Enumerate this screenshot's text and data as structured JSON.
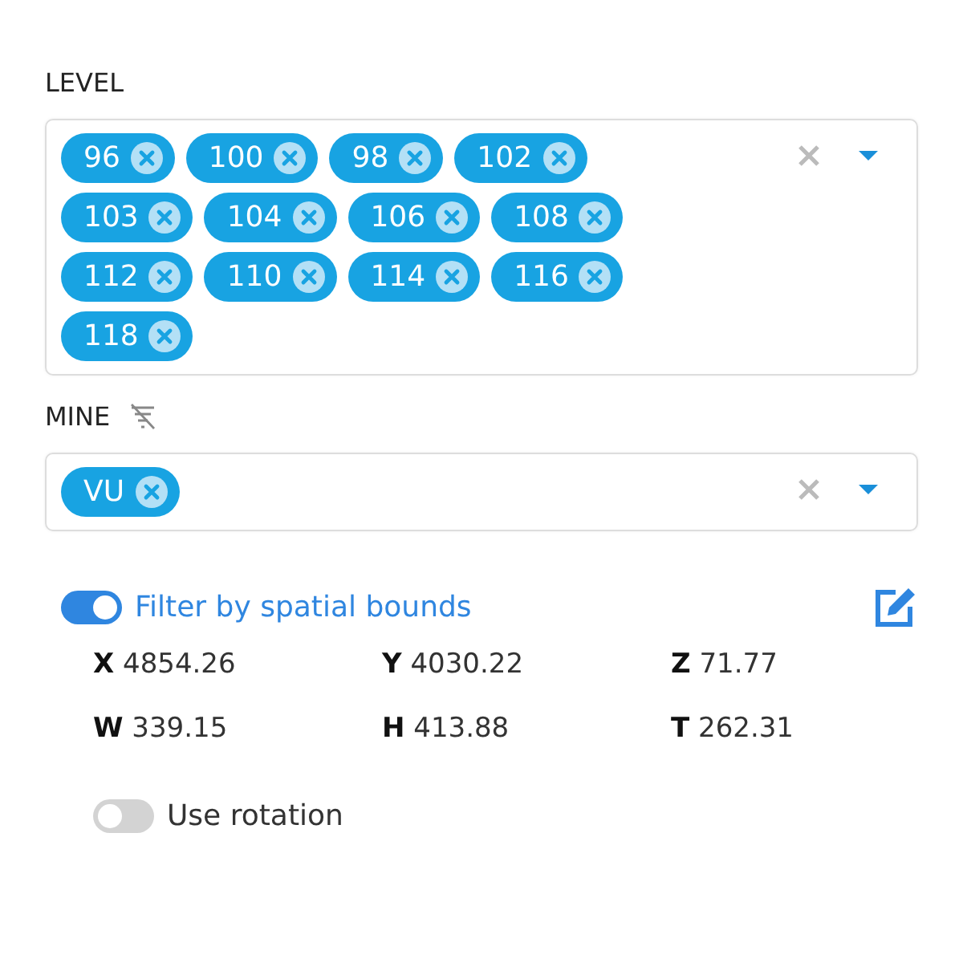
{
  "fields": [
    {
      "label": "LEVEL",
      "label_icon": false,
      "tags": [
        "96",
        "100",
        "98",
        "102",
        "103",
        "104",
        "106",
        "108",
        "112",
        "110",
        "114",
        "116",
        "118"
      ]
    },
    {
      "label": "MINE",
      "label_icon": true,
      "tags": [
        "VU"
      ]
    }
  ],
  "spatial_filter": {
    "label": "Filter by spatial bounds",
    "on": true,
    "coords": [
      {
        "axis": "X",
        "value": "4854.26"
      },
      {
        "axis": "Y",
        "value": "4030.22"
      },
      {
        "axis": "Z",
        "value": "71.77"
      },
      {
        "axis": "W",
        "value": "339.15"
      },
      {
        "axis": "H",
        "value": "413.88"
      },
      {
        "axis": "T",
        "value": "262.31"
      }
    ]
  },
  "rotation": {
    "label": "Use rotation",
    "on": false
  }
}
